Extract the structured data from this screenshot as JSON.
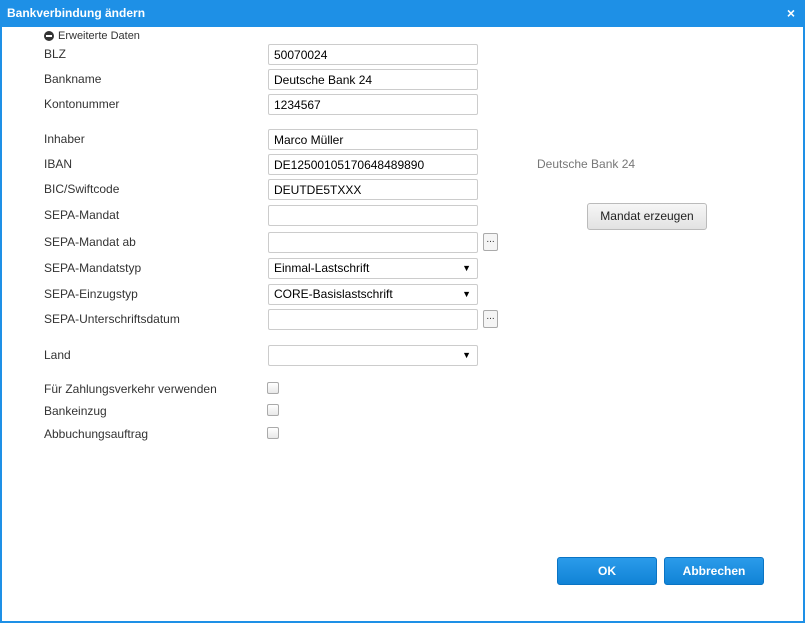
{
  "dialog": {
    "title": "Bankverbindung ändern",
    "close_symbol": "×"
  },
  "toggle": {
    "icon": "minus-circle-icon",
    "label": "Erweiterte Daten"
  },
  "fields": {
    "blz": {
      "label": "BLZ",
      "value": "50070024"
    },
    "bankname": {
      "label": "Bankname",
      "value": "Deutsche Bank 24"
    },
    "kontonummer": {
      "label": "Kontonummer",
      "value": "1234567"
    },
    "inhaber": {
      "label": "Inhaber",
      "value": "Marco Müller"
    },
    "iban": {
      "label": "IBAN",
      "value": "DE12500105170648489890",
      "hint": "Deutsche Bank 24"
    },
    "bic": {
      "label": "BIC/Swiftcode",
      "value": "DEUTDE5TXXX"
    },
    "sepa_mandat": {
      "label": "SEPA-Mandat",
      "value": ""
    },
    "sepa_mandat_ab": {
      "label": "SEPA-Mandat ab",
      "value": "",
      "picker": "..."
    },
    "sepa_mandatstyp": {
      "label": "SEPA-Mandatstyp",
      "selected": "Einmal-Lastschrift"
    },
    "sepa_einzugstyp": {
      "label": "SEPA-Einzugstyp",
      "selected": "CORE-Basislastschrift"
    },
    "sepa_unterschriftsdatum": {
      "label": "SEPA-Unterschriftsdatum",
      "value": "",
      "picker": "..."
    },
    "land": {
      "label": "Land",
      "selected": ""
    }
  },
  "checkboxes": {
    "zahlungsverkehr": {
      "label": "Für Zahlungsverkehr verwenden",
      "checked": false
    },
    "bankeinzug": {
      "label": "Bankeinzug",
      "checked": false
    },
    "abbuchungsauftrag": {
      "label": "Abbuchungsauftrag",
      "checked": false
    }
  },
  "buttons": {
    "mandat_erzeugen": "Mandat erzeugen",
    "ok": "OK",
    "cancel": "Abbrechen"
  },
  "select_arrow": "▼",
  "colors": {
    "accent": "#1e90e6",
    "hint_text": "#777777"
  }
}
